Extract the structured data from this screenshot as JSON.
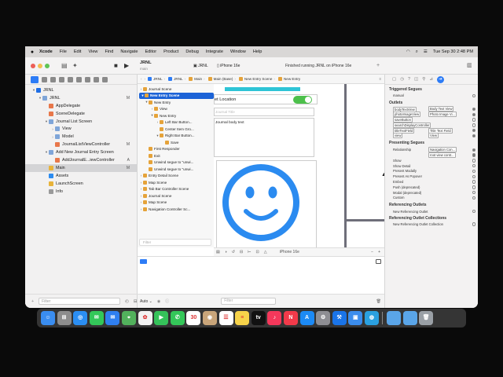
{
  "menubar": {
    "app": "Xcode",
    "items": [
      "File",
      "Edit",
      "View",
      "Find",
      "Navigate",
      "Editor",
      "Product",
      "Debug",
      "Integrate",
      "Window",
      "Help"
    ],
    "clock": "Tue Sep 30  2:48 PM"
  },
  "toolbar": {
    "project": "JRNL",
    "branch": "main",
    "scheme": "JRNL",
    "device": "iPhone 16e",
    "status": "Finished running JRNL on iPhone 16e"
  },
  "tabbar": {
    "crumbs": [
      "JRNL",
      "JRNL",
      "Main",
      "Main (Base)",
      "New Entry Scene",
      "New Entry"
    ]
  },
  "navigator": {
    "items": [
      {
        "label": "JRNL",
        "indent": 0,
        "caret": "▾",
        "icon": "#1f6ee5",
        "m": ""
      },
      {
        "label": "JRNL",
        "indent": 1,
        "caret": "▾",
        "icon": "#7fa5d8",
        "m": "M"
      },
      {
        "label": "AppDelegate",
        "indent": 2,
        "caret": "",
        "icon": "#e8774a",
        "m": ""
      },
      {
        "label": "SceneDelegate",
        "indent": 2,
        "caret": "",
        "icon": "#e8774a",
        "m": ""
      },
      {
        "label": "Journal List Screen",
        "indent": 2,
        "caret": "▾",
        "icon": "#7fa5d8",
        "m": ""
      },
      {
        "label": "View",
        "indent": 3,
        "caret": "›",
        "icon": "#7fa5d8",
        "m": ""
      },
      {
        "label": "Model",
        "indent": 3,
        "caret": "›",
        "icon": "#7fa5d8",
        "m": ""
      },
      {
        "label": "JournalListViewController",
        "indent": 3,
        "caret": "",
        "icon": "#e8774a",
        "m": "M"
      },
      {
        "label": "Add New Journal Entry Screen",
        "indent": 2,
        "caret": "▾",
        "icon": "#7fa5d8",
        "m": ""
      },
      {
        "label": "AddJournalE...iewController",
        "indent": 3,
        "caret": "",
        "icon": "#e8774a",
        "m": "A"
      },
      {
        "label": "Main",
        "indent": 2,
        "caret": "",
        "icon": "#e8b33a",
        "m": "M",
        "sel": true
      },
      {
        "label": "Assets",
        "indent": 2,
        "caret": "",
        "icon": "#2d8cf0",
        "m": ""
      },
      {
        "label": "LaunchScreen",
        "indent": 2,
        "caret": "",
        "icon": "#e8b33a",
        "m": ""
      },
      {
        "label": "Info",
        "indent": 2,
        "caret": "",
        "icon": "#9a9a9a",
        "m": ""
      }
    ],
    "filter_placeholder": "Filter"
  },
  "outline": {
    "items": [
      {
        "label": "Journal Scene",
        "indent": 0,
        "caret": "›",
        "sel": false
      },
      {
        "label": "New Entry Scene",
        "indent": 0,
        "caret": "▾",
        "sel": true
      },
      {
        "label": "New Entry",
        "indent": 1,
        "caret": "▾",
        "sel": false
      },
      {
        "label": "View",
        "indent": 2,
        "caret": "›",
        "sel": false
      },
      {
        "label": "New Entry",
        "indent": 2,
        "caret": "▾",
        "sel": false
      },
      {
        "label": "Left Bar Button...",
        "indent": 3,
        "caret": "›",
        "sel": false
      },
      {
        "label": "Center Item Gro...",
        "indent": 3,
        "caret": "",
        "sel": false
      },
      {
        "label": "Right Bar Button...",
        "indent": 3,
        "caret": "▾",
        "sel": false
      },
      {
        "label": "Save",
        "indent": 4,
        "caret": "",
        "sel": false
      },
      {
        "label": "First Responder",
        "indent": 1,
        "caret": "",
        "sel": false
      },
      {
        "label": "Exit",
        "indent": 1,
        "caret": "",
        "sel": false
      },
      {
        "label": "Unwind segue to \"unwi...",
        "indent": 1,
        "caret": "",
        "sel": false
      },
      {
        "label": "Unwind segue to \"unwi...",
        "indent": 1,
        "caret": "",
        "sel": false
      },
      {
        "label": "Entry Detail Scene",
        "indent": 0,
        "caret": "›",
        "sel": false
      },
      {
        "label": "Map Scene",
        "indent": 0,
        "caret": "›",
        "sel": false
      },
      {
        "label": "Tab Bar Controller Scene",
        "indent": 0,
        "caret": "›",
        "sel": false
      },
      {
        "label": "Journal Scene",
        "indent": 0,
        "caret": "›",
        "sel": false
      },
      {
        "label": "Map Scene",
        "indent": 0,
        "caret": "›",
        "sel": false
      },
      {
        "label": "Navigation Controller Sc...",
        "indent": 0,
        "caret": "›",
        "sel": false
      }
    ],
    "filter_placeholder": "Filter"
  },
  "canvas": {
    "location_label": "et Location",
    "title_placeholder": "Journal Title",
    "body_text": "Journal body text",
    "device": "iPhone 16e"
  },
  "inspector": {
    "triggered_title": "Triggered Segues",
    "triggered": [
      "manual"
    ],
    "outlets_title": "Outlets",
    "outlets": [
      {
        "name": "bodyTextView",
        "target": "Body Text View"
      },
      {
        "name": "photoImageView",
        "target": "Photo Image Vi..."
      },
      {
        "name": "saveButton",
        "target": ""
      },
      {
        "name": "searchDisplayController",
        "target": ""
      },
      {
        "name": "titleTextField",
        "target": "Title Text Field"
      },
      {
        "name": "view",
        "target": "View"
      }
    ],
    "presenting_title": "Presenting Segues",
    "presenting": [
      {
        "name": "Relationship",
        "target": "Navigation Con..."
      },
      {
        "name": "",
        "target": "root view contr..."
      },
      {
        "name": "Show",
        "target": ""
      },
      {
        "name": "Show Detail",
        "target": ""
      },
      {
        "name": "Present Modally",
        "target": ""
      },
      {
        "name": "Present As Popover",
        "target": ""
      },
      {
        "name": "Embed",
        "target": ""
      },
      {
        "name": "Push (deprecated)",
        "target": ""
      },
      {
        "name": "Modal (deprecated)",
        "target": ""
      },
      {
        "name": "Custom",
        "target": ""
      }
    ],
    "ref_outlets_title": "Referencing Outlets",
    "ref_outlets": [
      "New Referencing Outlet"
    ],
    "ref_coll_title": "Referencing Outlet Collections",
    "ref_coll": [
      "New Referencing Outlet Collection"
    ]
  },
  "debugbar": {
    "auto": "Auto ⌄",
    "filter_placeholder": "Filter"
  },
  "dock": {
    "apps": [
      {
        "name": "finder",
        "color": "#3a8df0",
        "glyph": "☺"
      },
      {
        "name": "launchpad",
        "color": "#8d8d8d",
        "glyph": "⊞"
      },
      {
        "name": "safari",
        "color": "#2b8ef2",
        "glyph": "◎"
      },
      {
        "name": "messages",
        "color": "#33c759",
        "glyph": "✉"
      },
      {
        "name": "mail",
        "color": "#2f7ff0",
        "glyph": "✉"
      },
      {
        "name": "maps",
        "color": "#52b15c",
        "glyph": "⌖"
      },
      {
        "name": "photos",
        "color": "#f2f2f2",
        "glyph": "✿"
      },
      {
        "name": "facetime",
        "color": "#35c25a",
        "glyph": "▶"
      },
      {
        "name": "phone",
        "color": "#34c759",
        "glyph": "✆"
      },
      {
        "name": "calendar",
        "color": "#ffffff",
        "glyph": "30"
      },
      {
        "name": "contacts",
        "color": "#c9a57a",
        "glyph": "◉"
      },
      {
        "name": "reminders",
        "color": "#ffffff",
        "glyph": "☰"
      },
      {
        "name": "notes",
        "color": "#f7d34a",
        "glyph": "≡"
      },
      {
        "name": "appletv",
        "color": "#111111",
        "glyph": "tv"
      },
      {
        "name": "music",
        "color": "#f5385b",
        "glyph": "♪"
      },
      {
        "name": "news",
        "color": "#f23a4a",
        "glyph": "N"
      },
      {
        "name": "appstore",
        "color": "#1c8af5",
        "glyph": "A"
      },
      {
        "name": "system-settings",
        "color": "#8e8e93",
        "glyph": "⚙"
      },
      {
        "name": "xcode",
        "color": "#1a74e8",
        "glyph": "⚒"
      },
      {
        "name": "preview",
        "color": "#3b8ded",
        "glyph": "▣"
      },
      {
        "name": "simulator",
        "color": "#2aa0e0",
        "glyph": "◍"
      },
      {
        "name": "folder",
        "color": "#5aa5e8",
        "glyph": ""
      },
      {
        "name": "folder2",
        "color": "#5aa5e8",
        "glyph": ""
      },
      {
        "name": "trash",
        "color": "#9aa0a6",
        "glyph": "🗑"
      }
    ]
  }
}
